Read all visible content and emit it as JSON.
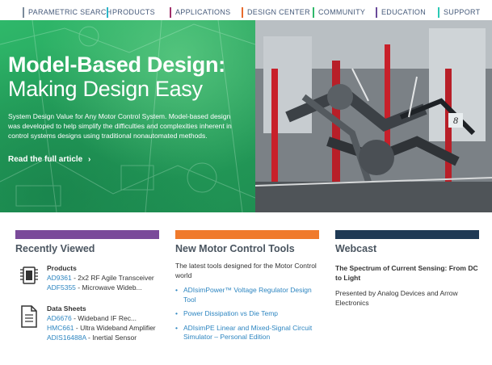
{
  "nav": {
    "items": [
      {
        "label": "PARAMETRIC SEARCH",
        "color": "#7a8a9a"
      },
      {
        "label": "PRODUCTS",
        "color": "#2bb5c9"
      },
      {
        "label": "APPLICATIONS",
        "color": "#a0306a"
      },
      {
        "label": "DESIGN CENTER",
        "color": "#e86a2c"
      },
      {
        "label": "COMMUNITY",
        "color": "#2fb86a"
      },
      {
        "label": "EDUCATION",
        "color": "#6a4a9a"
      },
      {
        "label": "SUPPORT",
        "color": "#2bc9b5"
      }
    ]
  },
  "hero": {
    "title_line1": "Model-Based Design:",
    "title_line2": "Making Design Easy",
    "description": "System Design Value for Any Motor Control System. Model-based design was developed to help simplify the difficulties and complexities inherent in control systems designs using traditional nonautomated methods.",
    "link_label": "Read the full article",
    "link_icon": "chevron-right-icon",
    "badge": "8",
    "left_color": "#2fb86a"
  },
  "recently_viewed": {
    "title": "Recently Viewed",
    "bar_color": "#7a4a9a",
    "products": {
      "heading": "Products",
      "icon": "chip-icon",
      "items": [
        {
          "code": "AD9361",
          "desc": " - 2x2 RF Agile Transceiver"
        },
        {
          "code": "ADF5355",
          "desc": " - Microwave Wideb..."
        }
      ]
    },
    "datasheets": {
      "heading": "Data Sheets",
      "icon": "document-icon",
      "items": [
        {
          "code": "AD6676",
          "desc": " - Wideband IF Rec..."
        },
        {
          "code": "HMC661",
          "desc": " - Ultra Wideband Amplifier"
        },
        {
          "code": "ADIS16488A",
          "desc": " - Inertial Sensor"
        }
      ]
    }
  },
  "tools": {
    "title": "New Motor Control Tools",
    "bar_color": "#f07a2c",
    "intro": "The latest tools designed for the Motor Control world",
    "items": [
      "ADIsimPower™ Voltage Regulator Design Tool",
      "Power Dissipation vs Die Temp",
      "ADIsimPE Linear and Mixed-Signal Circuit Simulator – Personal Edition"
    ]
  },
  "webcast": {
    "title": "Webcast",
    "bar_color": "#1f3a55",
    "event_title": "The Spectrum of Current Sensing: From DC to Light",
    "desc": "Presented by Analog Devices and Arrow Electronics"
  }
}
